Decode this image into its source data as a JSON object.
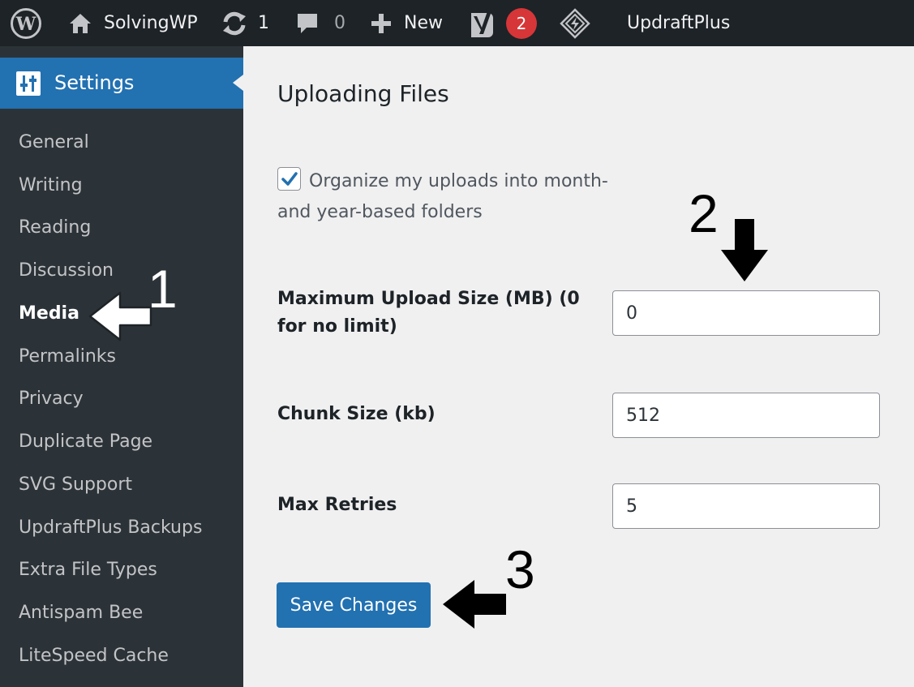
{
  "admin_bar": {
    "site_name": "SolvingWP",
    "updates_count": "1",
    "comments_count": "0",
    "new_label": "New",
    "yoast_badge": "2",
    "updraft_label": "UpdraftPlus"
  },
  "sidebar": {
    "menu_title": "Settings",
    "items": [
      {
        "label": "General"
      },
      {
        "label": "Writing"
      },
      {
        "label": "Reading"
      },
      {
        "label": "Discussion"
      },
      {
        "label": "Media",
        "current": true
      },
      {
        "label": "Permalinks"
      },
      {
        "label": "Privacy"
      },
      {
        "label": "Duplicate Page"
      },
      {
        "label": "SVG Support"
      },
      {
        "label": "UpdraftPlus Backups"
      },
      {
        "label": "Extra File Types"
      },
      {
        "label": "Antispam Bee"
      },
      {
        "label": "LiteSpeed Cache"
      }
    ]
  },
  "main": {
    "heading": "Uploading Files",
    "organize_checkbox": {
      "label": "Organize my uploads into month- and year-based folders",
      "checked": true
    },
    "fields": [
      {
        "label": "Maximum Upload Size (MB) (0 for no limit)",
        "value": "0"
      },
      {
        "label": "Chunk Size (kb)",
        "value": "512"
      },
      {
        "label": "Max Retries",
        "value": "5"
      }
    ],
    "save_label": "Save Changes"
  },
  "annotations": {
    "step_1": "1",
    "step_2": "2",
    "step_3": "3"
  },
  "colors": {
    "admin_bar": "#1d2327",
    "sidebar": "#2c3338",
    "accent": "#2271b1",
    "badge": "#d63638",
    "content_bg": "#f0f0f1"
  }
}
